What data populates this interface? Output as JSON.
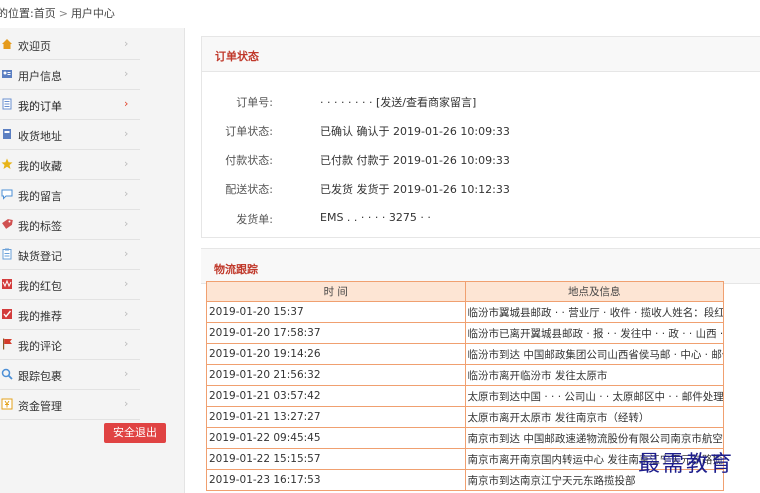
{
  "breadcrumb": {
    "lead": "的位置:",
    "home": "首页",
    "separator": ">",
    "current": "用户中心"
  },
  "sidebar": {
    "items": [
      {
        "label": "欢迎页",
        "icon": "house-icon",
        "color": "#e59b1c"
      },
      {
        "label": "用户信息",
        "icon": "user-card-icon",
        "color": "#5b7fc2"
      },
      {
        "label": "我的订单",
        "icon": "order-doc-icon",
        "color": "#6a8fcf",
        "active": true
      },
      {
        "label": "收货地址",
        "icon": "address-book-icon",
        "color": "#5b7fc2"
      },
      {
        "label": "我的收藏",
        "icon": "star-icon",
        "color": "#e8b418"
      },
      {
        "label": "我的留言",
        "icon": "speech-bubble-icon",
        "color": "#4c8fd6"
      },
      {
        "label": "我的标签",
        "icon": "tag-icon",
        "color": "#d05050"
      },
      {
        "label": "缺货登记",
        "icon": "clipboard-icon",
        "color": "#6aa0d8"
      },
      {
        "label": "我的红包",
        "icon": "red-envelope-icon",
        "color": "#d33c3c"
      },
      {
        "label": "我的推荐",
        "icon": "recommend-icon",
        "color": "#d33c3c"
      },
      {
        "label": "我的评论",
        "icon": "comment-flag-icon",
        "color": "#d43c2c"
      },
      {
        "label": "跟踪包裹",
        "icon": "package-search-icon",
        "color": "#4c8fd6"
      },
      {
        "label": "资金管理",
        "icon": "wallet-icon",
        "color": "#e3a21c"
      }
    ],
    "arrow": "›",
    "logout_label": "安全退出"
  },
  "order_status": {
    "title": "订单状态",
    "rows": [
      {
        "label": "订单号:",
        "value": "·  ·  ·  ·  ·  ·  ·   ·   [发送/查看商家留言]"
      },
      {
        "label": "订单状态:",
        "value": "已确认   确认于 2019-01-26 10:09:33"
      },
      {
        "label": "付款状态:",
        "value": "已付款   付款于 2019-01-26 10:09:33"
      },
      {
        "label": "配送状态:",
        "value": "已发货   发货于 2019-01-26 10:12:33"
      },
      {
        "label": "发货单:",
        "value": "EMS .  . ·  ·  · · 3275 · ·"
      }
    ]
  },
  "logistics": {
    "title": "物流跟踪",
    "columns": [
      "时 间",
      "地点及信息"
    ],
    "rows": [
      {
        "time": "2019-01-20 15:37",
        "info": "临汾市翼城县邮政 · · 营业厅 · 收件 · 揽收人姓名：段红线,联系电话：)"
      },
      {
        "time": "2019-01-20 17:58:37",
        "info": "临汾市已离开翼城县邮政 · 报 · · 发往中 · · 政 · · 山西 · · 处理中心"
      },
      {
        "time": "2019-01-20 19:14:26",
        "info": "临汾市到达 中国邮政集团公司山西省侯马邮 · 中心 · 邮件处理中心 处理中心"
      },
      {
        "time": "2019-01-20 21:56:32",
        "info": "临汾市离开临汾市 发往太原市"
      },
      {
        "time": "2019-01-21 03:57:42",
        "info": "太原市到达中国 · · · 公司山 · · 太原邮区中 · · 邮件处理中心处理中心（经转）"
      },
      {
        "time": "2019-01-21 13:27:27",
        "info": "太原市离开太原市 发往南京市（经转）"
      },
      {
        "time": "2019-01-22 09:45:45",
        "info": "南京市到达 中国邮政速递物流股份有限公司南京市航空邮件处理中心 处理中心"
      },
      {
        "time": "2019-01-22 15:15:57",
        "info": "南京市离开南京国内转运中心 发往南京江宁天元东路揽投部"
      },
      {
        "time": "2019-01-23 16:17:53",
        "info": "南京市到达南京江宁天元东路揽投部"
      }
    ]
  },
  "watermark": "最需教育",
  "colors": {
    "accent_red": "#c0392b",
    "table_border": "#f0a070",
    "table_header": "#fde5d4",
    "logout_bg": "#e04343",
    "active_arrow": "#e2432a"
  }
}
